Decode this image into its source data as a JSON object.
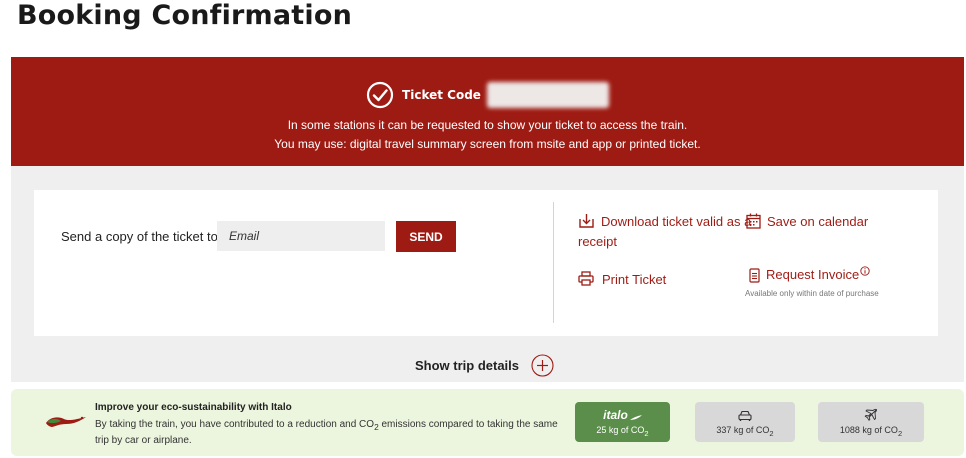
{
  "page": {
    "title": "Booking Confirmation"
  },
  "banner": {
    "ticket_code_label": "Ticket Code",
    "line1": "In some stations it can be requested to show your ticket to access the train.",
    "line2": "You may use: digital travel summary screen from msite and app or printed ticket."
  },
  "send_copy": {
    "label": "Send a copy of the ticket to:",
    "email_placeholder": "Email",
    "button_label": "SEND"
  },
  "actions": {
    "download": "Download ticket valid as a",
    "download_cont": "receipt",
    "calendar": "Save on calendar",
    "print": "Print Ticket",
    "invoice": "Request Invoice",
    "invoice_note": "Available only within date of purchase"
  },
  "trip_details": {
    "label": "Show trip details"
  },
  "eco": {
    "title": "Improve your eco-sustainability with Italo",
    "text_before": "By taking the train, you have contributed to a reduction and CO",
    "text_sub": "2",
    "text_after": " emissions compared to taking the same trip by car or airplane.",
    "italo_brand": "italo",
    "italo_value": "25 kg of CO",
    "car_value": "337 kg of CO",
    "plane_value": "1088 kg of CO",
    "sub": "2"
  },
  "colors": {
    "brand_red": "#9e1b13",
    "eco_bg": "#ecf5dd",
    "italo_green": "#5b8e4a"
  }
}
